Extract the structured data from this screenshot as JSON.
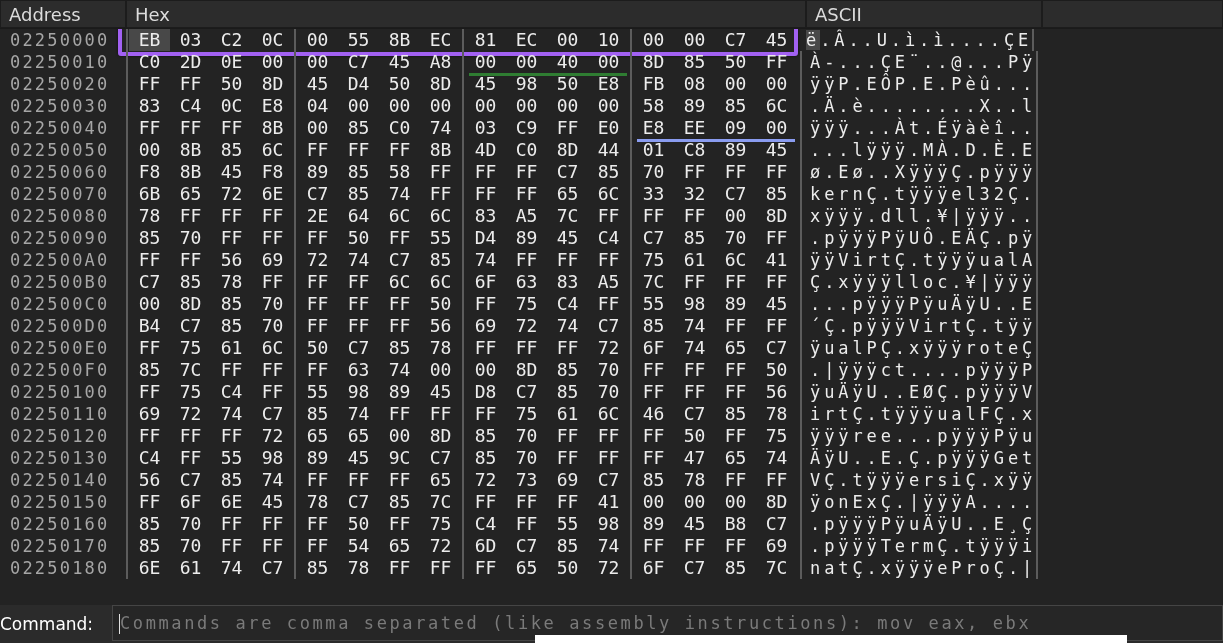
{
  "columns": [
    {
      "label": "Address"
    },
    {
      "label": "Hex"
    },
    {
      "label": "ASCII"
    }
  ],
  "rows": [
    {
      "address": "02250000",
      "framed": true,
      "cursor_at_start": true,
      "groups": [
        {
          "bytes": [
            "EB",
            "03",
            "C2",
            "0C"
          ]
        },
        {
          "bytes": [
            "00",
            "55",
            "8B",
            "EC"
          ]
        },
        {
          "bytes": [
            "81",
            "EC",
            "00",
            "10"
          ]
        },
        {
          "bytes": [
            "00",
            "00",
            "C7",
            "45"
          ]
        }
      ],
      "ascii": "ë.Â..U.ì.ì....ÇE"
    },
    {
      "address": "02250010",
      "framed": false,
      "cursor_at_start": false,
      "groups": [
        {
          "bytes": [
            "C0",
            "2D",
            "0E",
            "00"
          ]
        },
        {
          "bytes": [
            "00",
            "C7",
            "45",
            "A8"
          ]
        },
        {
          "bytes": [
            "00",
            "00",
            "40",
            "00"
          ],
          "color": "#2f7d32"
        },
        {
          "bytes": [
            "8D",
            "85",
            "50",
            "FF"
          ]
        }
      ],
      "ascii": "À-...ÇE¨..@...Pÿ"
    },
    {
      "address": "02250020",
      "framed": false,
      "cursor_at_start": false,
      "groups": [
        {
          "bytes": [
            "FF",
            "FF",
            "50",
            "8D"
          ]
        },
        {
          "bytes": [
            "45",
            "D4",
            "50",
            "8D"
          ]
        },
        {
          "bytes": [
            "45",
            "98",
            "50",
            "E8"
          ]
        },
        {
          "bytes": [
            "FB",
            "08",
            "00",
            "00"
          ]
        }
      ],
      "ascii": "ÿÿP.EÔP.E.Pèû..."
    },
    {
      "address": "02250030",
      "framed": false,
      "cursor_at_start": false,
      "groups": [
        {
          "bytes": [
            "83",
            "C4",
            "0C",
            "E8"
          ]
        },
        {
          "bytes": [
            "04",
            "00",
            "00",
            "00"
          ]
        },
        {
          "bytes": [
            "00",
            "00",
            "00",
            "00"
          ]
        },
        {
          "bytes": [
            "58",
            "89",
            "85",
            "6C"
          ]
        }
      ],
      "ascii": ".Ä.è........X..l"
    },
    {
      "address": "02250040",
      "framed": false,
      "cursor_at_start": false,
      "groups": [
        {
          "bytes": [
            "FF",
            "FF",
            "FF",
            "8B"
          ]
        },
        {
          "bytes": [
            "00",
            "85",
            "C0",
            "74"
          ]
        },
        {
          "bytes": [
            "03",
            "C9",
            "FF",
            "E0"
          ]
        },
        {
          "bytes": [
            "E8",
            "EE",
            "09",
            "00"
          ],
          "color": "#8a9cf0"
        }
      ],
      "ascii": "ÿÿÿ...Àt.Éÿàèî.."
    },
    {
      "address": "02250050",
      "framed": false,
      "cursor_at_start": false,
      "groups": [
        {
          "bytes": [
            "00",
            "8B",
            "85",
            "6C"
          ]
        },
        {
          "bytes": [
            "FF",
            "FF",
            "FF",
            "8B"
          ]
        },
        {
          "bytes": [
            "4D",
            "C0",
            "8D",
            "44"
          ]
        },
        {
          "bytes": [
            "01",
            "C8",
            "89",
            "45"
          ]
        }
      ],
      "ascii": "...lÿÿÿ.MÀ.D.È.E"
    },
    {
      "address": "02250060",
      "framed": false,
      "cursor_at_start": false,
      "groups": [
        {
          "bytes": [
            "F8",
            "8B",
            "45",
            "F8"
          ]
        },
        {
          "bytes": [
            "89",
            "85",
            "58",
            "FF"
          ]
        },
        {
          "bytes": [
            "FF",
            "FF",
            "C7",
            "85"
          ]
        },
        {
          "bytes": [
            "70",
            "FF",
            "FF",
            "FF"
          ]
        }
      ],
      "ascii": "ø.Eø..XÿÿÿÇ.pÿÿÿ"
    },
    {
      "address": "02250070",
      "framed": false,
      "cursor_at_start": false,
      "groups": [
        {
          "bytes": [
            "6B",
            "65",
            "72",
            "6E"
          ]
        },
        {
          "bytes": [
            "C7",
            "85",
            "74",
            "FF"
          ]
        },
        {
          "bytes": [
            "FF",
            "FF",
            "65",
            "6C"
          ]
        },
        {
          "bytes": [
            "33",
            "32",
            "C7",
            "85"
          ]
        }
      ],
      "ascii": "kernÇ.tÿÿÿel32Ç."
    },
    {
      "address": "02250080",
      "framed": false,
      "cursor_at_start": false,
      "groups": [
        {
          "bytes": [
            "78",
            "FF",
            "FF",
            "FF"
          ]
        },
        {
          "bytes": [
            "2E",
            "64",
            "6C",
            "6C"
          ]
        },
        {
          "bytes": [
            "83",
            "A5",
            "7C",
            "FF"
          ]
        },
        {
          "bytes": [
            "FF",
            "FF",
            "00",
            "8D"
          ]
        }
      ],
      "ascii": "xÿÿÿ.dll.¥|ÿÿÿ.."
    },
    {
      "address": "02250090",
      "framed": false,
      "cursor_at_start": false,
      "groups": [
        {
          "bytes": [
            "85",
            "70",
            "FF",
            "FF"
          ]
        },
        {
          "bytes": [
            "FF",
            "50",
            "FF",
            "55"
          ]
        },
        {
          "bytes": [
            "D4",
            "89",
            "45",
            "C4"
          ]
        },
        {
          "bytes": [
            "C7",
            "85",
            "70",
            "FF"
          ]
        }
      ],
      "ascii": ".pÿÿÿPÿUÔ.EÄÇ.pÿ"
    },
    {
      "address": "022500A0",
      "framed": false,
      "cursor_at_start": false,
      "groups": [
        {
          "bytes": [
            "FF",
            "FF",
            "56",
            "69"
          ]
        },
        {
          "bytes": [
            "72",
            "74",
            "C7",
            "85"
          ]
        },
        {
          "bytes": [
            "74",
            "FF",
            "FF",
            "FF"
          ]
        },
        {
          "bytes": [
            "75",
            "61",
            "6C",
            "41"
          ]
        }
      ],
      "ascii": "ÿÿVirtÇ.tÿÿÿualA"
    },
    {
      "address": "022500B0",
      "framed": false,
      "cursor_at_start": false,
      "groups": [
        {
          "bytes": [
            "C7",
            "85",
            "78",
            "FF"
          ]
        },
        {
          "bytes": [
            "FF",
            "FF",
            "6C",
            "6C"
          ]
        },
        {
          "bytes": [
            "6F",
            "63",
            "83",
            "A5"
          ]
        },
        {
          "bytes": [
            "7C",
            "FF",
            "FF",
            "FF"
          ]
        }
      ],
      "ascii": "Ç.xÿÿÿlloc.¥|ÿÿÿ"
    },
    {
      "address": "022500C0",
      "framed": false,
      "cursor_at_start": false,
      "groups": [
        {
          "bytes": [
            "00",
            "8D",
            "85",
            "70"
          ]
        },
        {
          "bytes": [
            "FF",
            "FF",
            "FF",
            "50"
          ]
        },
        {
          "bytes": [
            "FF",
            "75",
            "C4",
            "FF"
          ]
        },
        {
          "bytes": [
            "55",
            "98",
            "89",
            "45"
          ]
        }
      ],
      "ascii": "...pÿÿÿPÿuÄÿU..E"
    },
    {
      "address": "022500D0",
      "framed": false,
      "cursor_at_start": false,
      "groups": [
        {
          "bytes": [
            "B4",
            "C7",
            "85",
            "70"
          ]
        },
        {
          "bytes": [
            "FF",
            "FF",
            "FF",
            "56"
          ]
        },
        {
          "bytes": [
            "69",
            "72",
            "74",
            "C7"
          ]
        },
        {
          "bytes": [
            "85",
            "74",
            "FF",
            "FF"
          ]
        }
      ],
      "ascii": "´Ç.pÿÿÿVirtÇ.tÿÿ"
    },
    {
      "address": "022500E0",
      "framed": false,
      "cursor_at_start": false,
      "groups": [
        {
          "bytes": [
            "FF",
            "75",
            "61",
            "6C"
          ]
        },
        {
          "bytes": [
            "50",
            "C7",
            "85",
            "78"
          ]
        },
        {
          "bytes": [
            "FF",
            "FF",
            "FF",
            "72"
          ]
        },
        {
          "bytes": [
            "6F",
            "74",
            "65",
            "C7"
          ]
        }
      ],
      "ascii": "ÿualPÇ.xÿÿÿroteÇ"
    },
    {
      "address": "022500F0",
      "framed": false,
      "cursor_at_start": false,
      "groups": [
        {
          "bytes": [
            "85",
            "7C",
            "FF",
            "FF"
          ]
        },
        {
          "bytes": [
            "FF",
            "63",
            "74",
            "00"
          ]
        },
        {
          "bytes": [
            "00",
            "8D",
            "85",
            "70"
          ]
        },
        {
          "bytes": [
            "FF",
            "FF",
            "FF",
            "50"
          ]
        }
      ],
      "ascii": ".|ÿÿÿct....pÿÿÿP"
    },
    {
      "address": "02250100",
      "framed": false,
      "cursor_at_start": false,
      "groups": [
        {
          "bytes": [
            "FF",
            "75",
            "C4",
            "FF"
          ]
        },
        {
          "bytes": [
            "55",
            "98",
            "89",
            "45"
          ]
        },
        {
          "bytes": [
            "D8",
            "C7",
            "85",
            "70"
          ]
        },
        {
          "bytes": [
            "FF",
            "FF",
            "FF",
            "56"
          ]
        }
      ],
      "ascii": "ÿuÄÿU..EØÇ.pÿÿÿV"
    },
    {
      "address": "02250110",
      "framed": false,
      "cursor_at_start": false,
      "groups": [
        {
          "bytes": [
            "69",
            "72",
            "74",
            "C7"
          ]
        },
        {
          "bytes": [
            "85",
            "74",
            "FF",
            "FF"
          ]
        },
        {
          "bytes": [
            "FF",
            "75",
            "61",
            "6C"
          ]
        },
        {
          "bytes": [
            "46",
            "C7",
            "85",
            "78"
          ]
        }
      ],
      "ascii": "irtÇ.tÿÿÿualFÇ.x"
    },
    {
      "address": "02250120",
      "framed": false,
      "cursor_at_start": false,
      "groups": [
        {
          "bytes": [
            "FF",
            "FF",
            "FF",
            "72"
          ]
        },
        {
          "bytes": [
            "65",
            "65",
            "00",
            "8D"
          ]
        },
        {
          "bytes": [
            "85",
            "70",
            "FF",
            "FF"
          ]
        },
        {
          "bytes": [
            "FF",
            "50",
            "FF",
            "75"
          ]
        }
      ],
      "ascii": "ÿÿÿree...pÿÿÿPÿu"
    },
    {
      "address": "02250130",
      "framed": false,
      "cursor_at_start": false,
      "groups": [
        {
          "bytes": [
            "C4",
            "FF",
            "55",
            "98"
          ]
        },
        {
          "bytes": [
            "89",
            "45",
            "9C",
            "C7"
          ]
        },
        {
          "bytes": [
            "85",
            "70",
            "FF",
            "FF"
          ]
        },
        {
          "bytes": [
            "FF",
            "47",
            "65",
            "74"
          ]
        }
      ],
      "ascii": "ÄÿU..E.Ç.pÿÿÿGet"
    },
    {
      "address": "02250140",
      "framed": false,
      "cursor_at_start": false,
      "groups": [
        {
          "bytes": [
            "56",
            "C7",
            "85",
            "74"
          ]
        },
        {
          "bytes": [
            "FF",
            "FF",
            "FF",
            "65"
          ]
        },
        {
          "bytes": [
            "72",
            "73",
            "69",
            "C7"
          ]
        },
        {
          "bytes": [
            "85",
            "78",
            "FF",
            "FF"
          ]
        }
      ],
      "ascii": "VÇ.tÿÿÿersiÇ.xÿÿ"
    },
    {
      "address": "02250150",
      "framed": false,
      "cursor_at_start": false,
      "groups": [
        {
          "bytes": [
            "FF",
            "6F",
            "6E",
            "45"
          ]
        },
        {
          "bytes": [
            "78",
            "C7",
            "85",
            "7C"
          ]
        },
        {
          "bytes": [
            "FF",
            "FF",
            "FF",
            "41"
          ]
        },
        {
          "bytes": [
            "00",
            "00",
            "00",
            "8D"
          ]
        }
      ],
      "ascii": "ÿonExÇ.|ÿÿÿA...."
    },
    {
      "address": "02250160",
      "framed": false,
      "cursor_at_start": false,
      "groups": [
        {
          "bytes": [
            "85",
            "70",
            "FF",
            "FF"
          ]
        },
        {
          "bytes": [
            "FF",
            "50",
            "FF",
            "75"
          ]
        },
        {
          "bytes": [
            "C4",
            "FF",
            "55",
            "98"
          ]
        },
        {
          "bytes": [
            "89",
            "45",
            "B8",
            "C7"
          ]
        }
      ],
      "ascii": ".pÿÿÿPÿuÄÿU..E¸Ç"
    },
    {
      "address": "02250170",
      "framed": false,
      "cursor_at_start": false,
      "groups": [
        {
          "bytes": [
            "85",
            "70",
            "FF",
            "FF"
          ]
        },
        {
          "bytes": [
            "FF",
            "54",
            "65",
            "72"
          ]
        },
        {
          "bytes": [
            "6D",
            "C7",
            "85",
            "74"
          ]
        },
        {
          "bytes": [
            "FF",
            "FF",
            "FF",
            "69"
          ]
        }
      ],
      "ascii": ".pÿÿÿTermÇ.tÿÿÿi"
    },
    {
      "address": "02250180",
      "framed": false,
      "cursor_at_start": false,
      "groups": [
        {
          "bytes": [
            "6E",
            "61",
            "74",
            "C7"
          ]
        },
        {
          "bytes": [
            "85",
            "78",
            "FF",
            "FF"
          ]
        },
        {
          "bytes": [
            "FF",
            "65",
            "50",
            "72"
          ]
        },
        {
          "bytes": [
            "6F",
            "C7",
            "85",
            "7C"
          ]
        }
      ],
      "ascii": "natÇ.xÿÿÿeProÇ.|"
    }
  ],
  "command": {
    "label": "Command:",
    "placeholder": "Commands are comma separated (like assembly instructions): mov eax, ebx"
  }
}
